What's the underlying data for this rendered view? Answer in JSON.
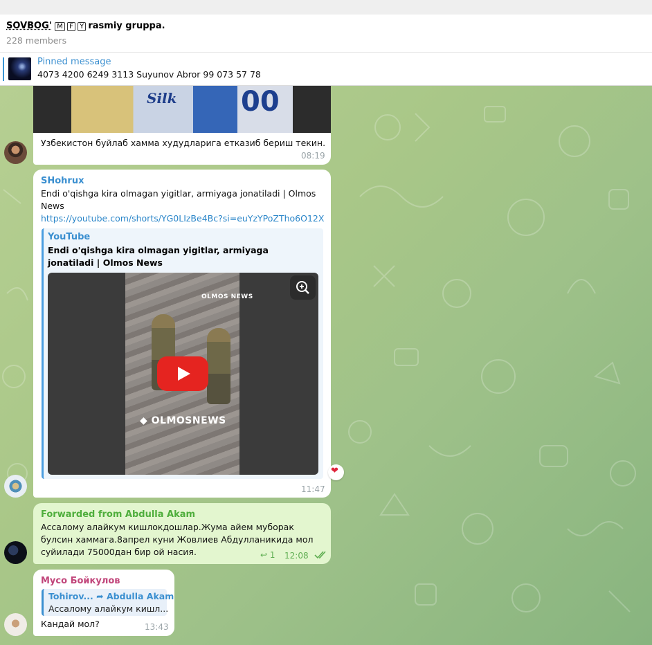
{
  "chat": {
    "title_prefix": "SOVBOG'",
    "title_badges": [
      "M",
      "F",
      "Y"
    ],
    "title_suffix": "rasmiy gruppa.",
    "members": "228 members"
  },
  "pinned": {
    "label": "Pinned message",
    "text": "4073 4200 6249 3113 Suyunov Abror 99 073 57 78"
  },
  "messages": [
    {
      "media_brand": "Silk",
      "text": "Узбекистон буйлаб хамма худудларига етказиб бериш текин.",
      "time": "08:19"
    },
    {
      "sender": "SHohrux",
      "text": "Endi o'qishga kira olmagan yigitlar, armiyaga jonatiladi  | Olmos News",
      "link": "https://youtube.com/shorts/YG0LIzBe4Bc?si=euYzYPoZTho6O12X",
      "preview_site": "YouTube",
      "preview_title": "Endi o'qishga kira olmagan yigitlar, armiyaga jonatiladi  | Olmos News",
      "video_brand": "OLMOSNEWS",
      "video_brand_small": "OLMOS NEWS",
      "time": "11:47"
    },
    {
      "forwarded": "Forwarded from Abdulla Akam",
      "text": "Ассалому алайкум кишлокдошлар.Жума айем муборак булсин хаммага.8апрел куни Жовлиев Абдулланикида мол суйилади 75000дан бир ой насия.",
      "replies": "1",
      "time": "12:08",
      "reaction": "❤"
    },
    {
      "sender": "Мусо Бойкулов",
      "reply_author": "Tohirov...",
      "reply_forward": "Abdulla Akam",
      "reply_text": "Ассалому алайкум кишл...",
      "text": "Кандай мол?",
      "time": "13:43"
    }
  ],
  "colors": {
    "accent": "#3a8fd0",
    "sender_blue": "#3a8fd0",
    "sender_green": "#4fae3c",
    "sender_pink": "#c1457a",
    "time_gray": "#9aa4a8",
    "chat_bg": "#a9c788"
  }
}
